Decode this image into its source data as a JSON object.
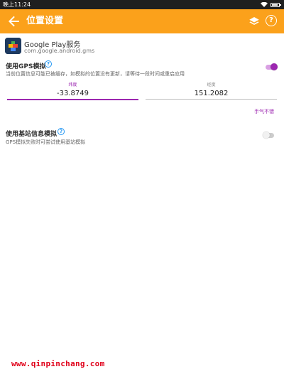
{
  "status_bar": {
    "time": "晚上11:24"
  },
  "app_bar": {
    "title": "位置设置",
    "background": "#fba11b",
    "back_icon": "arrow-left-icon",
    "layers_icon": "layers-icon",
    "help_icon": "help-circle-icon",
    "help_glyph": "?"
  },
  "app_info": {
    "name": "Google Play服务",
    "package": "com.google.android.gms"
  },
  "gps_mock": {
    "title": "使用GPS模拟",
    "help_glyph": "?",
    "description": "当前位置信息可能已被缓存，如模拟的位置没有更新，请等待一段时间或重启应用",
    "enabled": true,
    "accent_color": "#9c27b0",
    "latitude": {
      "label": "纬度",
      "value": "-33.8749"
    },
    "longitude": {
      "label": "经度",
      "value": "151.2082"
    },
    "action_label": "手气不错"
  },
  "cell_mock": {
    "title": "使用基站信息模拟",
    "help_glyph": "?",
    "description": "GPS模拟失败时可尝试使用基站模拟",
    "enabled": false
  },
  "watermark": "www.qinpinchang.com"
}
